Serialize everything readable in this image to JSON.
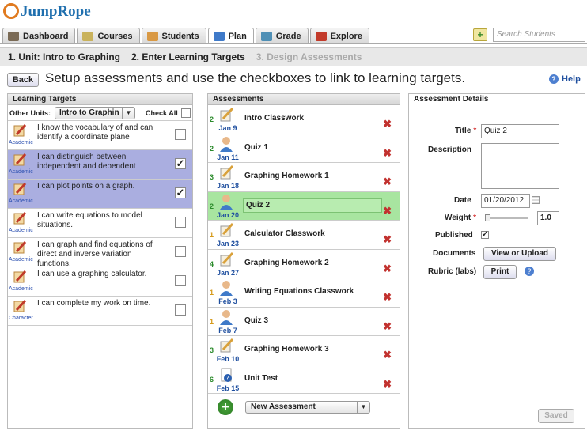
{
  "app": {
    "logo": "JumpRope"
  },
  "tabs": [
    {
      "label": "Dashboard",
      "icon": "home-icon",
      "color": "#7a6a55"
    },
    {
      "label": "Courses",
      "icon": "notepad-icon",
      "color": "#c9b25c"
    },
    {
      "label": "Students",
      "icon": "students-icon",
      "color": "#d99944"
    },
    {
      "label": "Plan",
      "icon": "plan-chart-icon",
      "color": "#3f7ac9"
    },
    {
      "label": "Grade",
      "icon": "grade-screen-icon",
      "color": "#4f8fb5"
    },
    {
      "label": "Explore",
      "icon": "explore-bars-icon",
      "color": "#c23a2a"
    }
  ],
  "search": {
    "placeholder": "Search Students"
  },
  "steps": [
    "1. Unit: Intro to Graphing",
    "2. Enter Learning Targets",
    "3. Design Assessments"
  ],
  "back": "Back",
  "headline": "Setup assessments and use the checkboxes to link to learning targets.",
  "help": "Help",
  "learning_targets": {
    "title": "Learning Targets",
    "other_units_label": "Other Units:",
    "units_value": "Intro to Graphin",
    "check_all": "Check All",
    "items": [
      {
        "text": "I know the vocabulary of and can identify a coordinate plane",
        "cat": "Academic",
        "checked": false,
        "selected": false
      },
      {
        "text": "I can distinguish between independent and dependent",
        "cat": "Academic",
        "checked": true,
        "selected": true
      },
      {
        "text": "I can plot points on a graph.",
        "cat": "Academic",
        "checked": true,
        "selected": true
      },
      {
        "text": "I can write equations to model situations.",
        "cat": "Academic",
        "checked": false,
        "selected": false
      },
      {
        "text": "I can graph and find equations of direct and inverse variation functions.",
        "cat": "Academic",
        "checked": false,
        "selected": false
      },
      {
        "text": "I can use a graphing calculator.",
        "cat": "Academic",
        "checked": false,
        "selected": false
      },
      {
        "text": "I can complete my work on time.",
        "cat": "Character",
        "checked": false,
        "selected": false
      }
    ]
  },
  "assessments": {
    "title": "Assessments",
    "items": [
      {
        "num": "2",
        "date": "Jan 9",
        "name": "Intro Classwork",
        "kind": "pencil",
        "color": "#2a8a2a"
      },
      {
        "num": "2",
        "date": "Jan 11",
        "name": "Quiz  1",
        "kind": "person",
        "color": "#2a8a2a"
      },
      {
        "num": "3",
        "date": "Jan 18",
        "name": "Graphing Homework 1",
        "kind": "pencil",
        "color": "#2a8a2a"
      },
      {
        "num": "2",
        "date": "Jan 20",
        "name": "Quiz 2",
        "kind": "person",
        "color": "#2a8a2a",
        "selected": true
      },
      {
        "num": "1",
        "date": "Jan 23",
        "name": "Calculator Classwork",
        "kind": "pencil",
        "color": "#d69a1a"
      },
      {
        "num": "4",
        "date": "Jan 27",
        "name": "Graphing Homework 2",
        "kind": "pencil",
        "color": "#2a8a2a"
      },
      {
        "num": "1",
        "date": "Feb 3",
        "name": "Writing Equations Classwork",
        "kind": "person",
        "color": "#d69a1a"
      },
      {
        "num": "1",
        "date": "Feb 7",
        "name": "Quiz 3",
        "kind": "person",
        "color": "#d69a1a"
      },
      {
        "num": "3",
        "date": "Feb 10",
        "name": "Graphing Homework 3",
        "kind": "pencil",
        "color": "#2a8a2a"
      },
      {
        "num": "6",
        "date": "Feb 15",
        "name": "Unit Test",
        "kind": "doc",
        "color": "#2a8a2a"
      }
    ],
    "new_label": "New Assessment"
  },
  "details": {
    "title": "Assessment Details",
    "title_label": "Title",
    "title_value": "Quiz 2",
    "description_label": "Description",
    "date_label": "Date",
    "date_value": "01/20/2012",
    "weight_label": "Weight",
    "weight_value": "1.0",
    "published_label": "Published",
    "published_check": "✓",
    "documents_label": "Documents",
    "documents_btn": "View or Upload",
    "rubric_label": "Rubric (labs)",
    "rubric_btn": "Print",
    "saved": "Saved"
  }
}
